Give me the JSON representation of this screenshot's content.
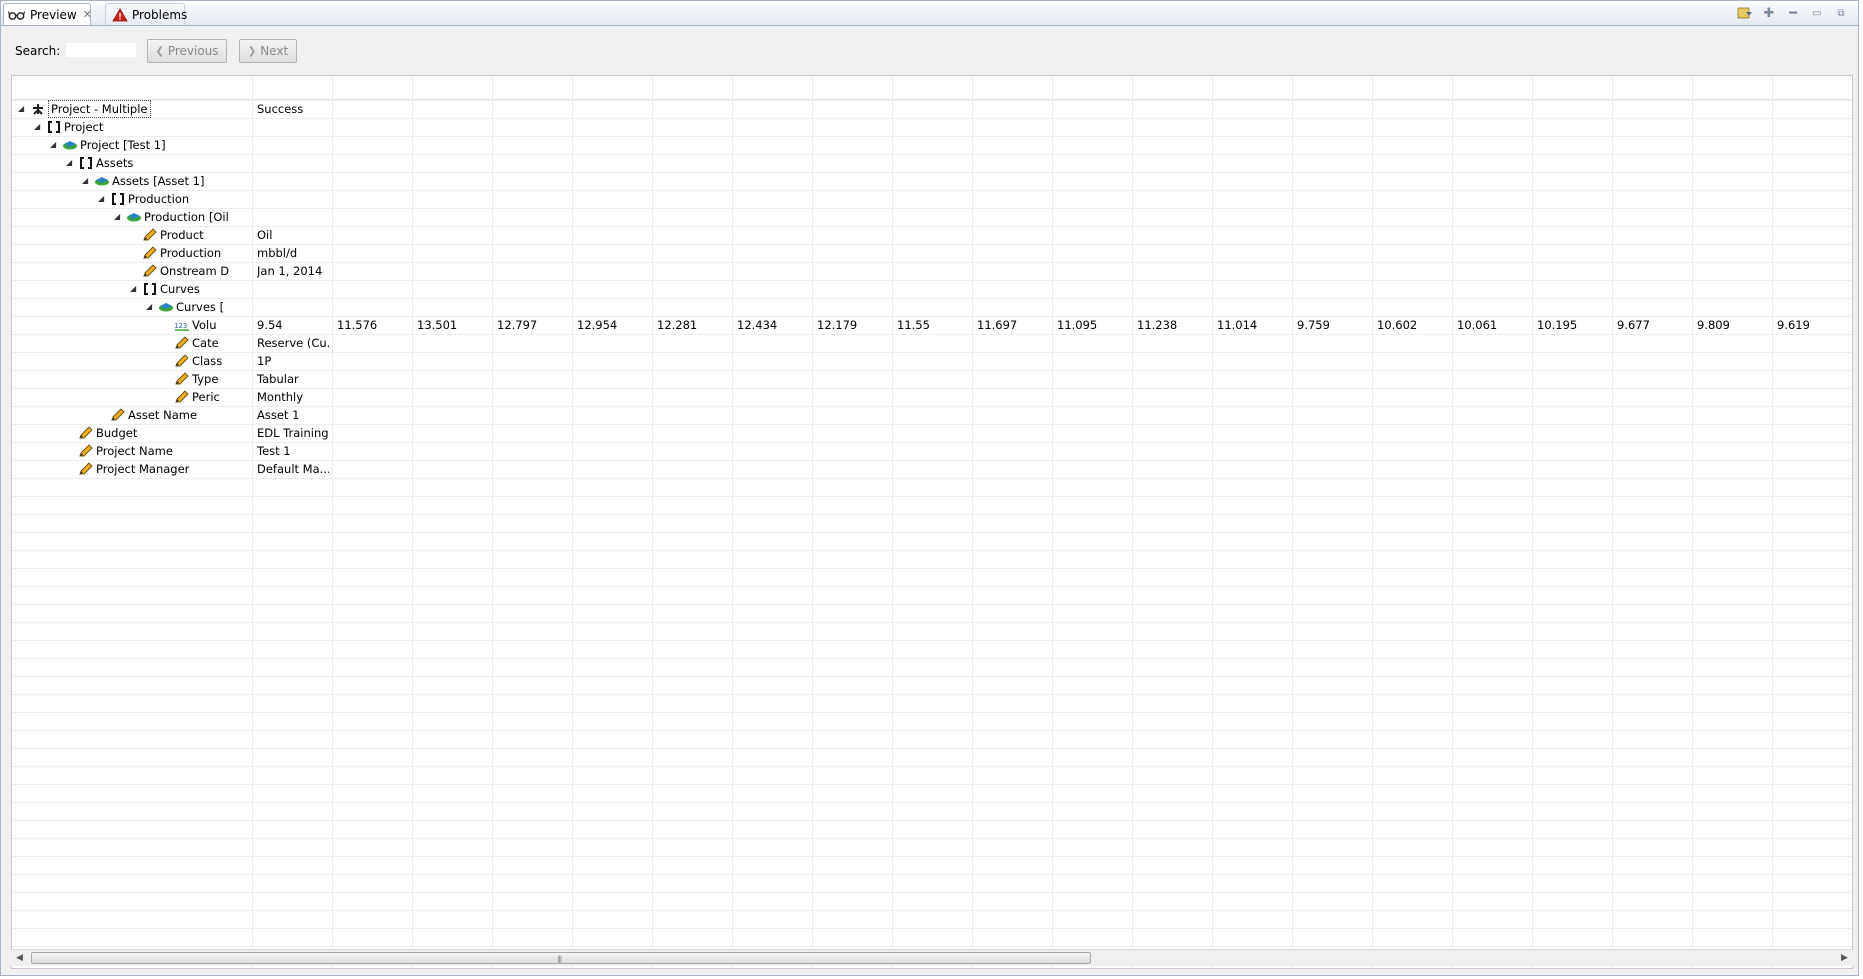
{
  "tabs": [
    {
      "label": "Preview",
      "icon": "glasses-icon",
      "active": true
    },
    {
      "label": "Problems",
      "icon": "warning-icon",
      "active": false
    }
  ],
  "toolbar": {
    "search_label": "Search:",
    "search_value": "",
    "previous_label": "Previous",
    "next_label": "Next"
  },
  "tree": {
    "rows": [
      {
        "label": "Project - Multiple",
        "value": "Success",
        "icon": "project-root-icon"
      },
      {
        "label": "Project",
        "value": "",
        "icon": "bracket-icon"
      },
      {
        "label": "Project [Test 1]",
        "value": "",
        "icon": "green-object-icon"
      },
      {
        "label": "Assets",
        "value": "",
        "icon": "bracket-icon"
      },
      {
        "label": "Assets [Asset 1]",
        "value": "",
        "icon": "green-object-icon"
      },
      {
        "label": "Production",
        "value": "",
        "icon": "bracket-icon"
      },
      {
        "label": "Production [Oil",
        "value": "",
        "icon": "green-object-icon"
      },
      {
        "label": "Product",
        "value": "Oil",
        "icon": "pencil-icon"
      },
      {
        "label": "Production",
        "value": "mbbl/d",
        "icon": "pencil-icon"
      },
      {
        "label": "Onstream D",
        "value": "Jan 1, 2014",
        "icon": "pencil-icon"
      },
      {
        "label": "Curves",
        "value": "",
        "icon": "bracket-icon"
      },
      {
        "label": "Curves [",
        "value": "",
        "icon": "green-object-icon"
      },
      {
        "label": "Volu",
        "value": "9.54",
        "icon": "numeric-series-icon"
      },
      {
        "label": "Cate",
        "value": "Reserve (Cu...",
        "icon": "pencil-icon"
      },
      {
        "label": "Class",
        "value": "1P",
        "icon": "pencil-icon"
      },
      {
        "label": "Type",
        "value": "Tabular",
        "icon": "pencil-icon"
      },
      {
        "label": "Peric",
        "value": "Monthly",
        "icon": "pencil-icon"
      },
      {
        "label": "Asset Name",
        "value": "Asset 1",
        "icon": "pencil-icon"
      },
      {
        "label": "Budget",
        "value": "EDL Training",
        "icon": "pencil-icon"
      },
      {
        "label": "Project Name",
        "value": "Test 1",
        "icon": "pencil-icon"
      },
      {
        "label": "Project Manager",
        "value": "Default Ma...",
        "icon": "pencil-icon"
      }
    ],
    "volume_values": [
      "11.576",
      "13.501",
      "12.797",
      "12.954",
      "12.281",
      "12.434",
      "12.179",
      "11.55",
      "11.697",
      "11.095",
      "11.238",
      "11.014",
      "9.759",
      "10.602",
      "10.061",
      "10.195",
      "9.677",
      "9.809",
      "9.619"
    ]
  },
  "colors": {
    "accent_green": "#3aa53a",
    "warning_red": "#d02020",
    "pencil_yellow": "#e8b020"
  }
}
